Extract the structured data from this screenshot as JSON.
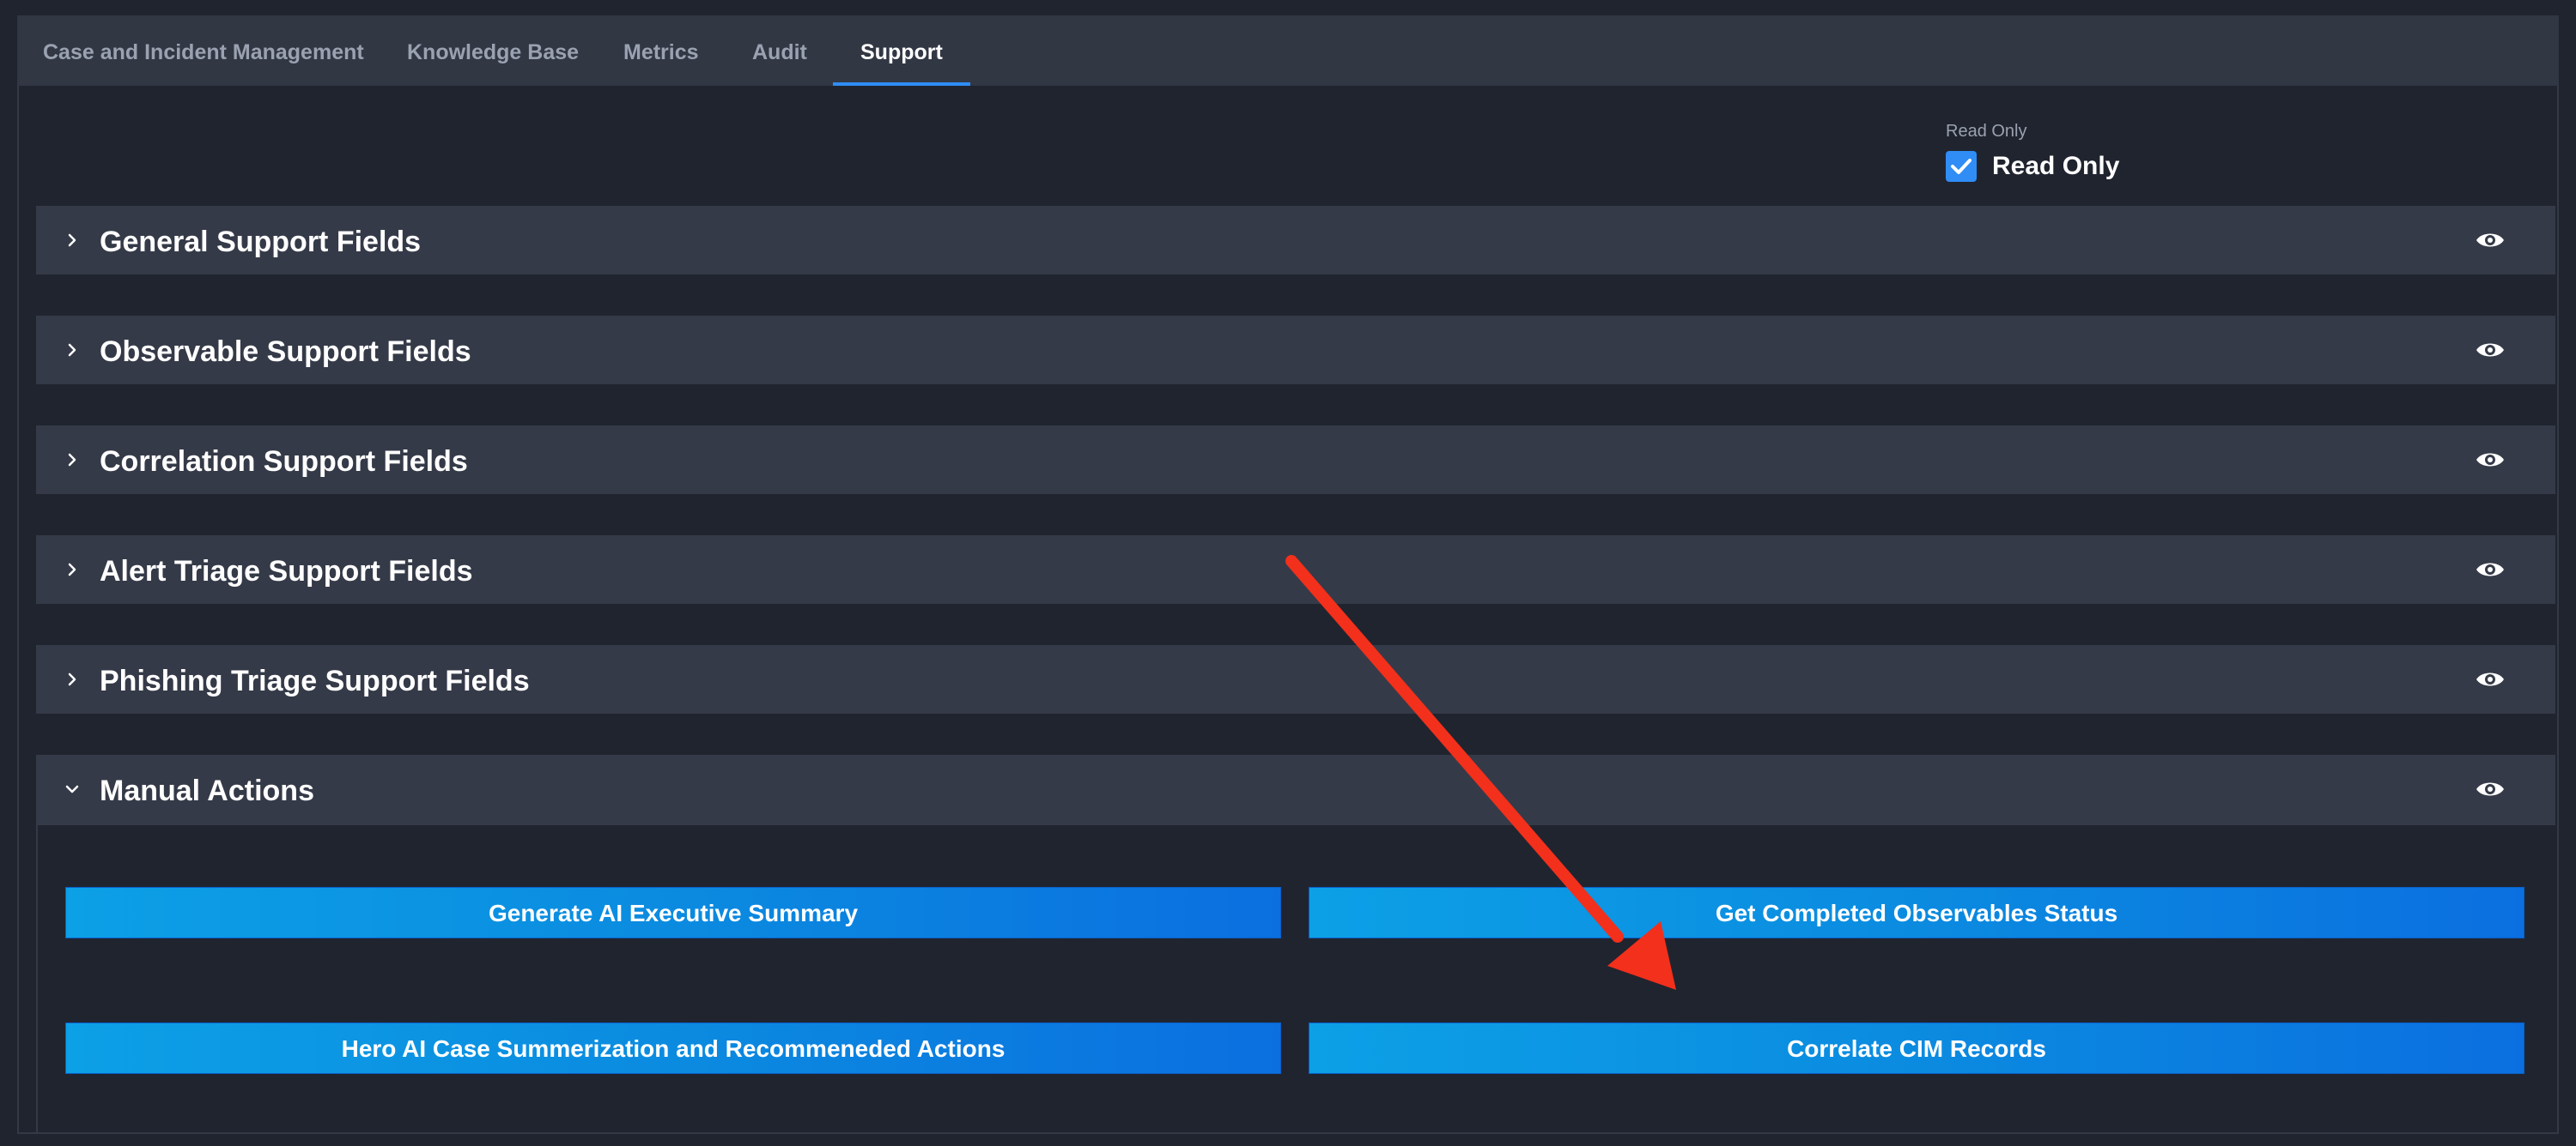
{
  "tabs": [
    {
      "label": "Case and Incident Management",
      "active": false
    },
    {
      "label": "Knowledge Base",
      "active": false
    },
    {
      "label": "Metrics",
      "active": false
    },
    {
      "label": "Audit",
      "active": false
    },
    {
      "label": "Support",
      "active": true
    }
  ],
  "read_only": {
    "caption": "Read Only",
    "label": "Read Only",
    "checked": true
  },
  "sections": [
    {
      "title": "General Support Fields",
      "expanded": false,
      "icon": "eye-icon"
    },
    {
      "title": "Observable Support Fields",
      "expanded": false,
      "icon": "eye-icon"
    },
    {
      "title": "Correlation Support Fields",
      "expanded": false,
      "icon": "eye-icon"
    },
    {
      "title": "Alert Triage Support Fields",
      "expanded": false,
      "icon": "eye-icon"
    },
    {
      "title": "Phishing Triage Support Fields",
      "expanded": false,
      "icon": "eye-icon"
    },
    {
      "title": "Manual Actions",
      "expanded": true,
      "icon": "eye-icon"
    }
  ],
  "manual_actions": {
    "buttons": [
      {
        "label": "Generate AI Executive Summary"
      },
      {
        "label": "Get Completed Observables Status"
      },
      {
        "label": "Hero AI Case Summerization and Recommeneded Actions"
      },
      {
        "label": "Correlate CIM Records"
      }
    ]
  },
  "colors": {
    "background": "#20242f",
    "tab_bar": "#323744",
    "section_header": "#353a48",
    "accent": "#2f8df5",
    "button_gradient_start": "#0ca0e6",
    "button_gradient_end": "#0b6fe0",
    "annotation_arrow": "#f2301b"
  }
}
